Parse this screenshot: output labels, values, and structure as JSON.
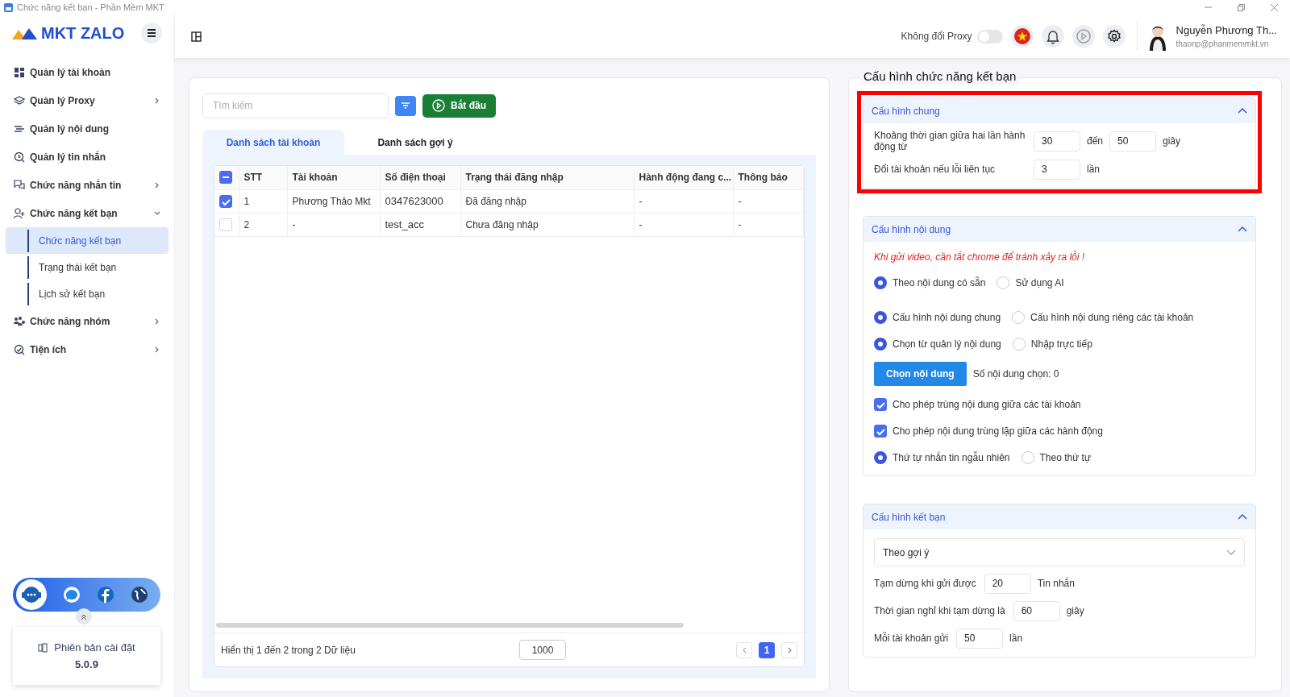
{
  "window": {
    "title": "Chức năng kết bạn - Phần Mềm MKT"
  },
  "sidebar": {
    "logo": "MKT ZALO",
    "items": [
      {
        "label": "Quản lý tài khoản"
      },
      {
        "label": "Quản lý Proxy",
        "expanded": false
      },
      {
        "label": "Quản lý nội dung"
      },
      {
        "label": "Quản lý tin nhắn"
      },
      {
        "label": "Chức năng nhắn tin",
        "expanded": false
      },
      {
        "label": "Chức năng kết bạn",
        "expanded": true,
        "children": [
          {
            "label": "Chức năng kết bạn",
            "selected": true
          },
          {
            "label": "Trạng thái kết bạn",
            "selected": false
          },
          {
            "label": "Lịch sử kết bạn",
            "selected": false
          }
        ]
      },
      {
        "label": "Chức năng nhóm",
        "expanded": false
      },
      {
        "label": "Tiện ích",
        "expanded": false
      }
    ],
    "version_label": "Phiên bản cài đặt",
    "version": "5.0.9"
  },
  "header": {
    "proxy_label": "Không đổi Proxy",
    "proxy_on": false,
    "user_name": "Nguyễn Phương Th...",
    "user_email": "thaonp@phanmemmkt.vn"
  },
  "accounts": {
    "search": {
      "placeholder": "Tìm kiếm"
    },
    "start_button": "Bắt đầu",
    "tabs": [
      {
        "label": "Danh sách tài khoản",
        "selected": true
      },
      {
        "label": "Danh sách gợi ý",
        "selected": false
      }
    ],
    "table": {
      "indeterminate": true,
      "columns": [
        "STT",
        "Tài khoản",
        "Số điện thoại",
        "Trạng thái đăng nhập",
        "Hành động đang c...",
        "Thông báo"
      ],
      "rows": [
        {
          "checked": true,
          "cells": [
            "1",
            "Phương Thảo Mkt",
            "0347623000",
            "Đã đăng nhập",
            "-",
            "-"
          ]
        },
        {
          "checked": false,
          "cells": [
            "2",
            "-",
            "test_acc",
            "Chưa đăng nhập",
            "-",
            "-"
          ]
        }
      ]
    },
    "footer": {
      "summary": "Hiển thị 1 đến 2 trong 2 Dữ liệu",
      "page_size": "1000",
      "pages": [
        {
          "label": "1",
          "selected": true
        }
      ]
    }
  },
  "config": {
    "title": "Cấu hình chức năng kết bạn",
    "sections": [
      {
        "title": "Cấu hình chung",
        "expanded": true,
        "highlighted": true,
        "rows": [
          {
            "kind": "inputs",
            "label": "Khoảng thời gian giữa hai lần hành động từ",
            "parts": [
              {
                "kind": "input",
                "value": "30"
              },
              {
                "kind": "unit",
                "text": "đến"
              },
              {
                "kind": "input",
                "value": "50"
              },
              {
                "kind": "unit",
                "text": "giây"
              }
            ]
          },
          {
            "kind": "inputs",
            "label": "Đổi tài khoản nếu lỗi liên tục",
            "parts": [
              {
                "kind": "input",
                "value": "3"
              },
              {
                "kind": "unit",
                "text": "lần"
              }
            ]
          }
        ]
      },
      {
        "title": "Cấu hình nội dung",
        "expanded": true,
        "highlighted": false,
        "rows": [
          {
            "kind": "note",
            "text": "Khi gửi video, cần tắt chrome để tránh xảy ra lỗi !"
          },
          {
            "kind": "radios",
            "options": [
              {
                "label": "Theo nội dung có sẵn",
                "selected": true
              },
              {
                "label": "Sử dụng AI",
                "selected": false
              }
            ]
          },
          {
            "kind": "radios",
            "options": [
              {
                "label": "Cấu hình nội dung chung",
                "selected": true
              },
              {
                "label": "Cấu hình nội dung riêng các tài khoản",
                "selected": false
              }
            ]
          },
          {
            "kind": "radios",
            "options": [
              {
                "label": "Chọn từ quản lý nội dung",
                "selected": true
              },
              {
                "label": "Nhập trực tiếp",
                "selected": false
              }
            ]
          },
          {
            "kind": "action",
            "button": "Chọn nội dung",
            "text": "Số nội dung chọn: 0"
          },
          {
            "kind": "checkbox",
            "label": "Cho phép trùng nội dung giữa các tài khoản",
            "checked": true
          },
          {
            "kind": "checkbox",
            "label": "Cho phép nội dung trùng lặp giữa các hành động",
            "checked": true
          },
          {
            "kind": "radios",
            "options": [
              {
                "label": "Thứ tự nhắn tin ngẫu nhiên",
                "selected": true
              },
              {
                "label": "Theo thứ tự",
                "selected": false
              }
            ]
          }
        ]
      },
      {
        "title": "Cấu hình kết bạn",
        "expanded": true,
        "highlighted": false,
        "rows": [
          {
            "kind": "select",
            "value": "Theo gợi ý"
          },
          {
            "kind": "inputs",
            "label": "Tạm dừng khi gửi được",
            "parts": [
              {
                "kind": "input",
                "value": "20"
              },
              {
                "kind": "unit",
                "text": "Tin nhắn"
              }
            ]
          },
          {
            "kind": "inputs",
            "label": "Thời gian nghỉ khi tạm dừng là",
            "parts": [
              {
                "kind": "input",
                "value": "60"
              },
              {
                "kind": "unit",
                "text": "giây"
              }
            ]
          },
          {
            "kind": "inputs",
            "label": "Mỗi tài khoản gửi",
            "parts": [
              {
                "kind": "input",
                "value": "50"
              },
              {
                "kind": "unit",
                "text": "lần"
              }
            ]
          }
        ]
      }
    ]
  }
}
